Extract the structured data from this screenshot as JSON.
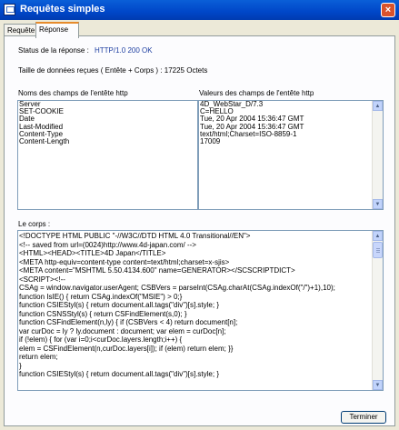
{
  "window": {
    "title": "Requêtes simples",
    "close_label": "×"
  },
  "tabs": [
    {
      "label": "Requête"
    },
    {
      "label": "Réponse"
    }
  ],
  "status": {
    "label": "Status de la réponse :",
    "value": "HTTP/1.0 200 OK"
  },
  "size": {
    "text": "Taille de données reçues ( Entête + Corps ) : 17225 Octets"
  },
  "headers": {
    "names_label": "Noms des champs de l'entête http",
    "values_label": "Valeurs des champs de l'entête http",
    "names": [
      "Server",
      "SET-COOKIE",
      "Date",
      "Last-Modified",
      "Content-Type",
      "Content-Length"
    ],
    "values": [
      "4D_WebStar_D/7.3",
      "C=HELLO",
      "Tue, 20 Apr 2004 15:36:47 GMT",
      "Tue, 20 Apr 2004 15:36:47 GMT",
      "text/html;Charset=ISO-8859-1",
      "17009"
    ]
  },
  "body": {
    "label": "Le corps :",
    "lines": [
      "<!DOCTYPE HTML PUBLIC \"-//W3C//DTD HTML 4.0 Transitional//EN\">",
      "<!-- saved from url=(0024)http://www.4d-japan.com/ -->",
      "<HTML><HEAD><TITLE>4D Japan</TITLE>",
      "<META http-equiv=content-type content=text/html;charset=x-sjis>",
      "<META content=\"MSHTML 5.50.4134.600\" name=GENERATOR></SCSCRIPTDICT>",
      "<SCRIPT><!--",
      "CSAg = window.navigator.userAgent; CSBVers = parseInt(CSAg.charAt(CSAg.indexOf(\"/\")+1),10);",
      "function IsIE() { return CSAg.indexOf(\"MSIE\") > 0;}",
      "function CSIEStyl(s) { return document.all.tags(\"div\")[s].style; }",
      "function CSNSStyl(s) { return CSFindElement(s,0); }",
      "function CSFindElement(n,ly) { if (CSBVers < 4) return document[n];",
      " var curDoc = ly ? ly.document : document; var elem = curDoc[n];",
      " if (!elem) { for (var i=0;i<curDoc.layers.length;i++) {",
      "   elem = CSFindElement(n,curDoc.layers[i]); if (elem) return elem; }}",
      " return elem;",
      "}",
      "function CSIEStyl(s) { return document.all.tags(\"div\")[s].style; }"
    ]
  },
  "footer": {
    "close_button": "Terminer"
  },
  "colors": {
    "titlebar": "#0054e3",
    "accent_value": "#1d3ea0",
    "panel_bg": "#ece9d8",
    "close": "#d8522c"
  }
}
